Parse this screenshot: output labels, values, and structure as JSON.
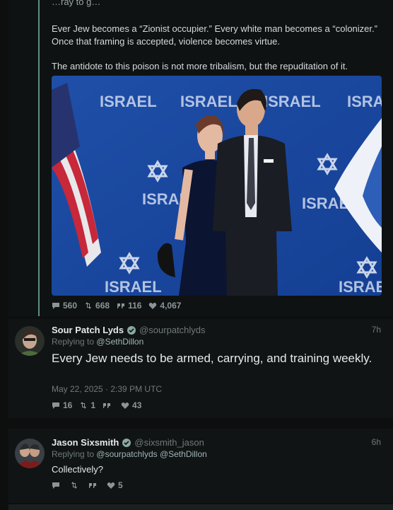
{
  "thread": {
    "cut_line": "…ray to g…",
    "paragraph1": "Ever Jew becomes a “Zionist occupier.” Every white man becomes a “colonizer.” Once that framing is accepted, violence becomes virtue.",
    "paragraph2": "The antidote to this poison is not more tribalism, but the repuditation of it.",
    "photo_backdrop_text": "ISRAEL",
    "stats": {
      "replies": "560",
      "retweets": "668",
      "quotes": "116",
      "likes": "4,067"
    }
  },
  "replies": [
    {
      "name": "Sour Patch Lyds",
      "handle": "@sourpatchlyds",
      "time": "7h",
      "replying_prefix": "Replying to",
      "replying_to": "@SethDillon",
      "text": "Every Jew needs to be armed, carrying, and training weekly.",
      "datetime": "May 22, 2025 · 2:39 PM UTC",
      "stats": {
        "replies": "16",
        "retweets": "1",
        "quotes": "",
        "likes": "43"
      }
    },
    {
      "name": "Jason Sixsmith",
      "handle": "@sixsmith_jason",
      "time": "6h",
      "replying_prefix": "Replying to",
      "replying_to": "@sourpatchlyds @SethDillon",
      "text": "Collectively?",
      "stats": {
        "replies": "",
        "retweets": "",
        "quotes": "",
        "likes": "5"
      }
    }
  ],
  "colors": {
    "background": "#0d0f0f",
    "panel": "#111414",
    "accent_line": "#5f8f80",
    "verified": "#8aa8a0"
  }
}
